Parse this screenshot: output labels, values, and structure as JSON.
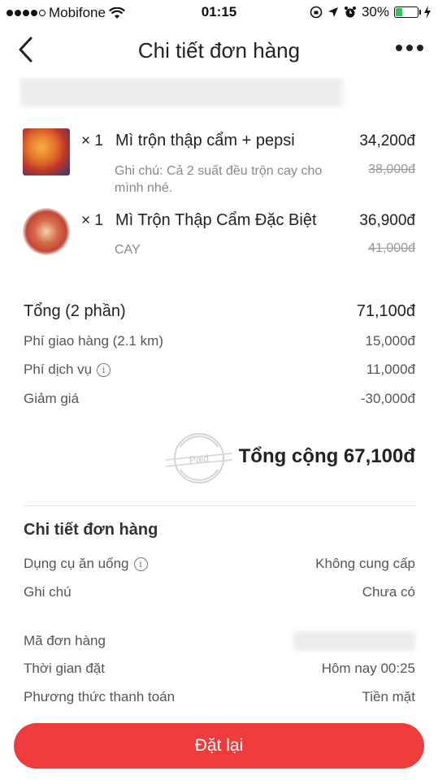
{
  "status_bar": {
    "carrier": "Mobifone",
    "time": "01:15",
    "battery": "30%",
    "battery_level": 0.3
  },
  "nav": {
    "title": "Chi tiết đơn hàng"
  },
  "items": [
    {
      "qty": "× 1",
      "name": "Mì trộn thập cẩm + pepsi",
      "price": "34,200đ",
      "note": "Ghi chú: Cả 2 suất đều trộn cay cho mình nhé.",
      "old_price": "38,000đ"
    },
    {
      "qty": "× 1",
      "name": "Mì Trộn Thập Cẩm Đặc Biệt",
      "price": "36,900đ",
      "note": "CAY",
      "old_price": "41,000đ"
    }
  ],
  "summary": {
    "subtotal_label": "Tổng (2 phần)",
    "subtotal_value": "71,100đ",
    "delivery_label": "Phí giao hàng (2.1 km)",
    "delivery_value": "15,000đ",
    "service_label": "Phí dịch vụ",
    "service_value": "11,000đ",
    "discount_label": "Giảm giá",
    "discount_value": "-30,000đ",
    "paid_stamp": "Paid",
    "grand_total": "Tổng cộng 67,100đ"
  },
  "details": {
    "title": "Chi tiết đơn hàng",
    "utensils_label": "Dụng cụ ăn uống",
    "utensils_value": "Không cung cấp",
    "note_label": "Ghi chú",
    "note_value": "Chưa có",
    "order_id_label": "Mã đơn hàng",
    "order_time_label": "Thời gian đặt",
    "order_time_value": "Hôm nay 00:25",
    "payment_label": "Phương thức thanh toán",
    "payment_value": "Tiền mặt"
  },
  "actions": {
    "reorder": "Đặt lại"
  },
  "colors": {
    "accent": "#ee3b3b",
    "battery": "#35c05a"
  }
}
